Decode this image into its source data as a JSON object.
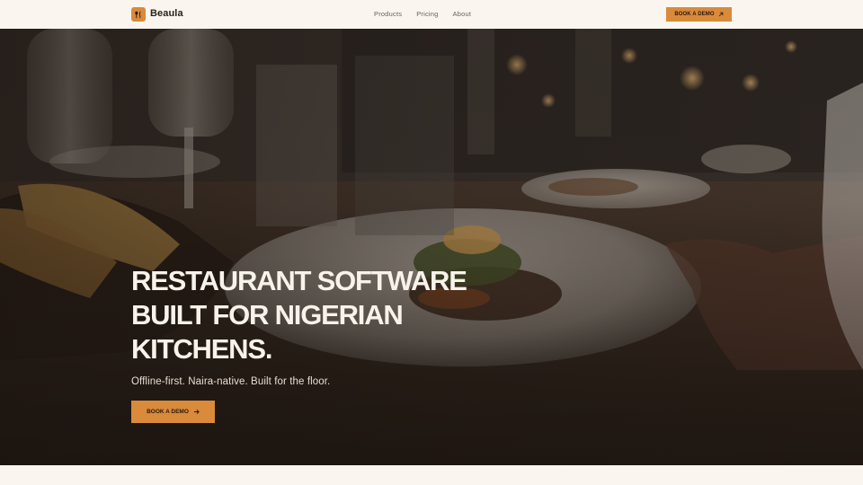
{
  "nav": {
    "brand": "Beaula",
    "logo_icon": "utensils-icon",
    "links": [
      {
        "label": "Products"
      },
      {
        "label": "Pricing"
      },
      {
        "label": "About"
      }
    ],
    "cta_label": "BOOK A DEMO",
    "cta_icon": "arrow-up-right-icon"
  },
  "hero": {
    "headline_lines": [
      "RESTAURANT SOFTWARE",
      "BUILT FOR NIGERIAN",
      "KITCHENS."
    ],
    "subhead": "Offline-first. Naira-native. Built for the floor.",
    "cta_label": "BOOK A DEMO",
    "cta_icon": "arrow-right-icon",
    "image_subject": "restaurant-table-photo"
  },
  "colors": {
    "accent": "#d98a3a",
    "background": "#faf6ef",
    "text_dark": "#2a211b",
    "text_light": "#f7f2ea"
  }
}
